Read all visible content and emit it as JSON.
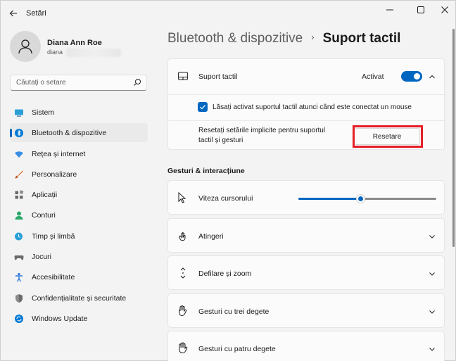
{
  "window": {
    "title": "Setări"
  },
  "profile": {
    "name": "Diana Ann Roe",
    "email": "diana"
  },
  "search": {
    "placeholder": "Căutați o setare"
  },
  "sidebar": {
    "items": [
      {
        "label": "Sistem",
        "icon": "system-icon"
      },
      {
        "label": "Bluetooth & dispozitive",
        "icon": "bluetooth-icon",
        "active": true
      },
      {
        "label": "Rețea și internet",
        "icon": "wifi-icon"
      },
      {
        "label": "Personalizare",
        "icon": "brush-icon"
      },
      {
        "label": "Aplicații",
        "icon": "apps-icon"
      },
      {
        "label": "Conturi",
        "icon": "person-icon"
      },
      {
        "label": "Timp și limbă",
        "icon": "globe-clock-icon"
      },
      {
        "label": "Jocuri",
        "icon": "gamepad-icon"
      },
      {
        "label": "Accesibilitate",
        "icon": "accessibility-icon"
      },
      {
        "label": "Confidențialitate și securitate",
        "icon": "shield-icon"
      },
      {
        "label": "Windows Update",
        "icon": "update-icon"
      }
    ]
  },
  "breadcrumb": {
    "parent": "Bluetooth & dispozitive",
    "separator": "›",
    "current": "Suport tactil"
  },
  "touchpad": {
    "label": "Suport tactil",
    "status": "Activat",
    "enabled": true,
    "mouse_checkbox_label": "Lăsați activat suportul tactil atunci când este conectat un mouse",
    "mouse_checkbox_checked": true,
    "reset_text_line1": "Resetați setările implicite pentru suportul",
    "reset_text_line2": "tactil și gesturi",
    "reset_button": "Resetare"
  },
  "gestures": {
    "header": "Gesturi & interacțiune",
    "cursor_speed_label": "Viteza cursorului",
    "cursor_speed_fraction": 0.45,
    "items": [
      {
        "label": "Atingeri",
        "icon": "tap-icon"
      },
      {
        "label": "Defilare și zoom",
        "icon": "scroll-zoom-icon"
      },
      {
        "label": "Gesturi cu trei degete",
        "icon": "three-finger-icon"
      },
      {
        "label": "Gesturi cu patru degete",
        "icon": "four-finger-icon"
      }
    ]
  },
  "colors": {
    "accent": "#0067c0",
    "highlight": "#e41e26",
    "background": "#f3f3f3",
    "card": "#fbfbfb"
  }
}
